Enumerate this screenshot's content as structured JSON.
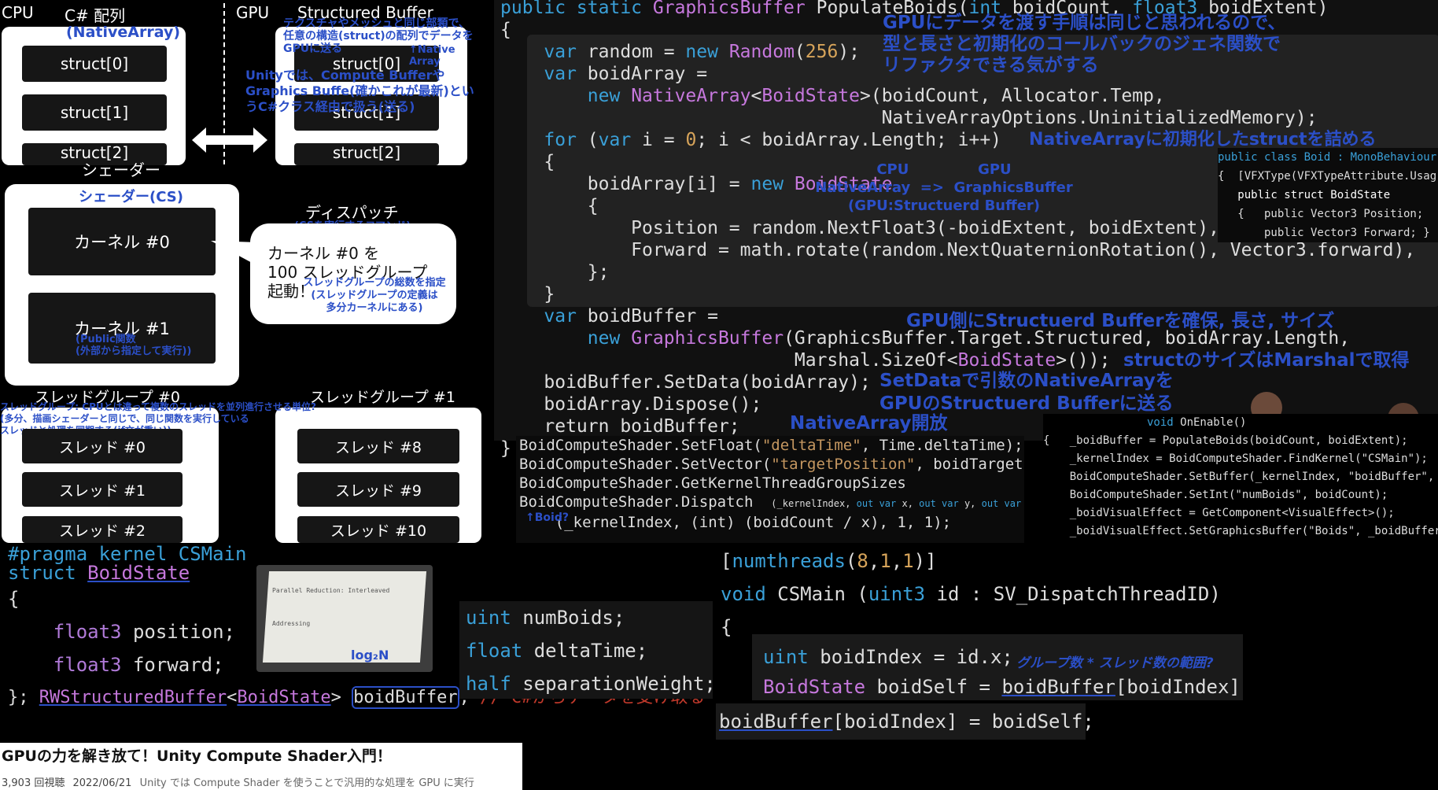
{
  "slide": {
    "hdr_cpu": "CPU",
    "hdr_csarray": "C# 配列",
    "hdr_gpu": "GPU",
    "hdr_sbuffer": "Structured Buffer",
    "note_nativearray": "(NativeArray)",
    "note_top_right": "テクスチャやメッシュと同じ部類で、任意の構造(struct)の配列でデータをGPUに送る",
    "note_native_array_small": "↑Native Array",
    "note_unity": "Unityでは、Compute Bufferや Graphics Buffe(確かこれが最新)というC#クラス経由で扱う(送る)",
    "structs_left": [
      "struct[0]",
      "struct[1]",
      "struct[2]"
    ],
    "structs_right": [
      "struct[0]",
      "struct[1]",
      "struct[2]"
    ],
    "shader_label": "シェーダー",
    "shader_cs": "シェーダー(CS)",
    "kernel0": "カーネル #0",
    "kernel1": "カーネル #1",
    "kernel1_note": "(Public関数\n(外部から指定して実行))",
    "dispatch_title": "ディスパッチ",
    "dispatch_note": "(CSを実行するコマンド)",
    "dispatch_bubble": "カーネル #0 を\n100 スレッドグループ\n起動！",
    "dispatch_bubble_note": "スレッドグループの総数を指定\n(スレッドグループの定義は\n多分カーネルにある)",
    "tg0": "スレッドグループ #0",
    "tg1": "スレッドグループ #1",
    "tg_note": "スレッドグループ: CPUとは違って複数のスレッドを並列進行させる単位?\n(多分、描画シェーダーと同じで、同じ関数を実行している\nスレッドと処理を同期する(if文が重い))",
    "threads_left": [
      "スレッド #0",
      "スレッド #1",
      "スレッド #2"
    ],
    "threads_right": [
      "スレッド #8",
      "スレッド #9",
      "スレッド #10"
    ]
  },
  "code_main": {
    "lines": [
      "public static GraphicsBuffer PopulateBoids(int boidCount, float3 boidExtent)",
      "{",
      "    var random = new Random(256);",
      "    var boidArray =",
      "        new NativeArray<BoidState>(boidCount, Allocator.Temp,",
      "                                   NativeArrayOptions.UninitializedMemory);",
      "    for (var i = 0; i < boidArray.Length; i++)",
      "    {",
      "        boidArray[i] = new BoidState",
      "        {",
      "            Position = random.NextFloat3(-boidExtent, boidExtent),",
      "            Forward = math.rotate(random.NextQuaternionRotation(), Vector3.forward),",
      "        };",
      "    }",
      "    var boidBuffer =",
      "        new GraphicsBuffer(GraphicsBuffer.Target.Structured, boidArray.Length,",
      "                           Marshal.SizeOf<BoidState>());",
      "    boidBuffer.SetData(boidArray);",
      "    boidArray.Dispose();",
      "    return boidBuffer;",
      "}"
    ],
    "note_top": "GPUにデータを渡す手順は同じと思われるので、\n型と長さと初期化のコールバックのジェネ関数で\nリファクタできる気がする",
    "note_nativearray_init": "NativeArrayに初期化したstructを詰める",
    "note_cpu_gpu": "CPU              GPU\nNativeArray  =>  GraphicsBuffer\n(GPU:Structuerd Buffer)",
    "note_gpu_side": "GPU側にStructuerd Bufferを確保, 長さ, サイズ",
    "note_marshal": "structのサイズはMarshalで取得",
    "note_setdata": "SetDataで引数のNativeArrayを\nGPUのStructuerd Bufferに送る",
    "note_dispose": "NativeArray開放"
  },
  "code_boid_class": {
    "lines": [
      "public class Boid : MonoBehaviour",
      "{  [VFXType(VFXTypeAttribute.Usag",
      "   public struct BoidState",
      "   {   public Vector3 Position;",
      "       public Vector3 Forward; }"
    ]
  },
  "code_onenable": {
    "lines": [
      "void OnEnable()",
      "{   _boidBuffer = PopulateBoids(boidCount, boidExtent);",
      "    _kernelIndex = BoidComputeShader.FindKernel(\"CSMain\");",
      "    BoidComputeShader.SetBuffer(_kernelIndex, \"boidBuffer\",",
      "    BoidComputeShader.SetInt(\"numBoids\", boidCount);",
      "    _boidVisualEffect = GetComponent<VisualEffect>();",
      "    _boidVisualEffect.SetGraphicsBuffer(\"Boids\", _boidBuffer);"
    ],
    "note_boidbuffer": "_boidBuffer);"
  },
  "code_dispatch": {
    "lines": [
      "BoidComputeShader.SetFloat(\"deltaTime\", Time.deltaTime);",
      "BoidComputeShader.SetVector(\"targetPosition\", boidTarget",
      "BoidComputeShader.GetKernelThreadGroupSizes",
      "BoidComputeShader.Dispatch  (_kernelIndex, out var x, out var y, out var z);",
      "    (_kernelIndex, (int) (boidCount / x), 1, 1);"
    ],
    "note_boid": "↑Boid?"
  },
  "code_hlsl": {
    "lines": [
      "#pragma kernel CSMain",
      "struct BoidState",
      "{",
      "    float3 position;",
      "    float3 forward;",
      "}; RWStructuredBuffer<BoidState> boidBuffer; // C#からデータを受け取る"
    ],
    "log_note": "log₂N",
    "photo_title": "Parallel Reduction: Interleaved Addressing"
  },
  "code_uniforms": {
    "lines": [
      "uint numBoids;",
      "float deltaTime;",
      "half separationWeight;"
    ]
  },
  "code_csmain": {
    "lines": [
      "[numthreads(8,1,1)]",
      "void CSMain (uint3 id : SV_DispatchThreadID)",
      "{",
      "    uint boidIndex = id.x;",
      "    BoidState boidSelf = boidBuffer[boidIndex];",
      "boidBuffer[boidIndex] = boidSelf;"
    ],
    "note_range": "グループ数 * スレッド数の範囲?"
  },
  "video": {
    "title": "GPUの力を解き放て！Unity Compute Shader入門！",
    "views": "3,903 回視聴",
    "date": "2022/06/21",
    "desc": "Unity では Compute Shader を使うことで汎用的な処理を GPU に実行"
  },
  "colors": {
    "note_blue": "#2b4fc7",
    "keyword": "#3aa0d8",
    "type": "#c678dd",
    "number": "#d7a45a",
    "comment": "#c0392b"
  }
}
